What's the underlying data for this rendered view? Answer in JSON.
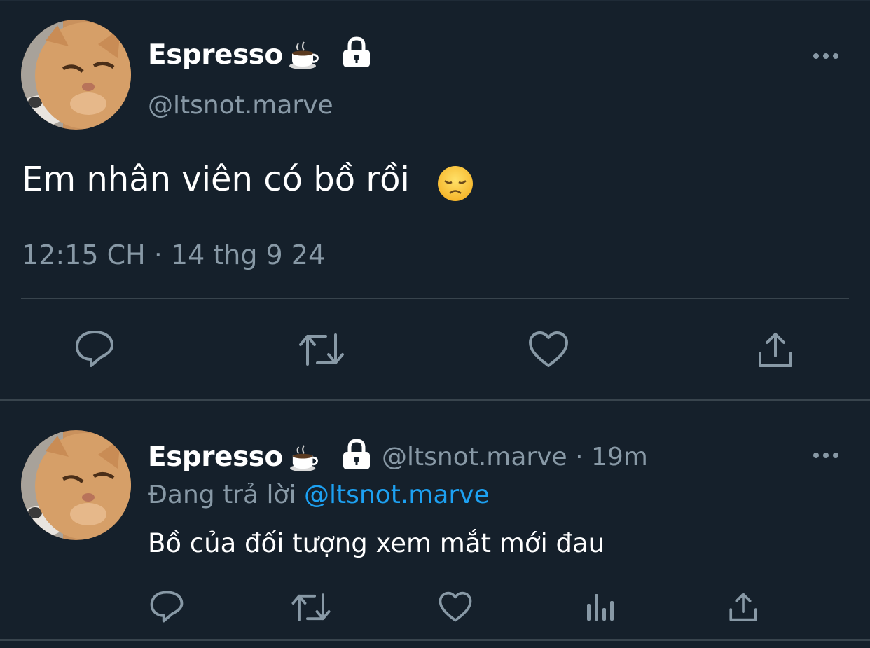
{
  "main_tweet": {
    "display_name": "Espresso",
    "name_emoji": "coffee-icon",
    "protected_icon": "lock-icon",
    "handle": "@ltsnot.marve",
    "text": "Em nhân viên có bồ rồi",
    "text_emoji": "disappointed-face-icon",
    "timestamp": "12:15 CH · 14 thg 9 24",
    "actions": [
      "reply-icon",
      "retweet-icon",
      "like-icon",
      "share-icon"
    ]
  },
  "reply_tweet": {
    "display_name": "Espresso",
    "name_emoji": "coffee-icon",
    "protected_icon": "lock-icon",
    "handle_time": "@ltsnot.marve · 19m",
    "replying_prefix": "Đang trả lời",
    "replying_to": "@ltsnot.marve",
    "text": "Bồ của đối tượng xem mắt mới đau",
    "actions": [
      "reply-icon",
      "retweet-icon",
      "like-icon",
      "analytics-icon",
      "share-icon"
    ]
  },
  "colors": {
    "background": "#15202b",
    "secondary_text": "#8899a6",
    "link": "#1da1f2",
    "divider": "#38444d"
  }
}
